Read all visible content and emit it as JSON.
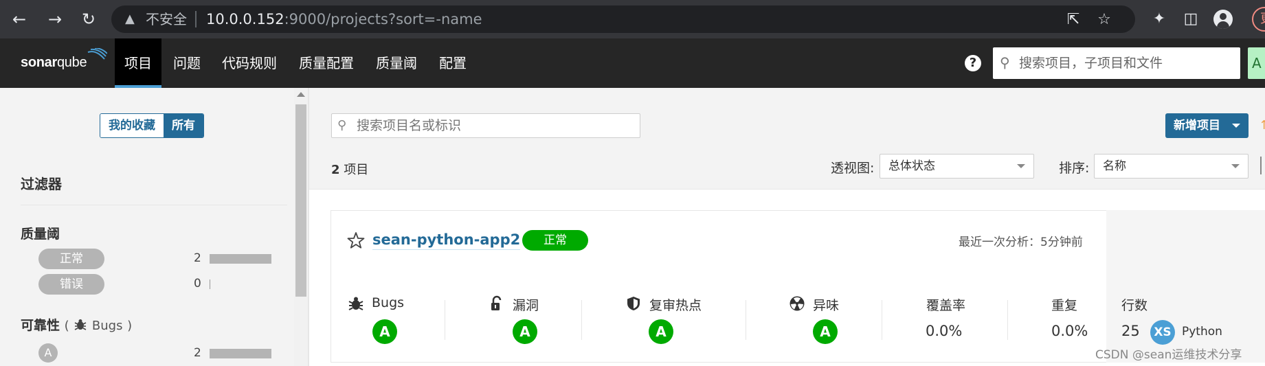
{
  "browser": {
    "security_text": "不安全",
    "url_host": "10.0.0.152",
    "url_rest": ":9000/projects?sort=-name",
    "update_label": "更"
  },
  "nav": {
    "logo_sonar": "sonar",
    "logo_qube": "qube",
    "items": [
      {
        "label": "项目",
        "active": true
      },
      {
        "label": "问题"
      },
      {
        "label": "代码规则"
      },
      {
        "label": "质量配置"
      },
      {
        "label": "质量阈"
      },
      {
        "label": "配置"
      }
    ],
    "help_label": "?",
    "search_placeholder": "搜索项目，子项目和文件",
    "new_chip": "A"
  },
  "sidebar": {
    "toggle_favorites": "我的收藏",
    "toggle_all": "所有",
    "filters_title": "过滤器",
    "quality_gate": {
      "title": "质量阈",
      "items": [
        {
          "label": "正常",
          "count": "2",
          "fraction": 1.0
        },
        {
          "label": "错误",
          "count": "0",
          "fraction": 0.0
        }
      ]
    },
    "reliability": {
      "title": "可靠性",
      "sub_open": "(",
      "sub_label": "Bugs",
      "sub_close": ")",
      "items": [
        {
          "rating": "A",
          "count": "2",
          "fraction": 1.0
        }
      ]
    }
  },
  "main": {
    "search_placeholder": "搜索项目名或标识",
    "create_button": "新增项目",
    "count_number": "2",
    "count_label": "项目",
    "perspective_label": "透视图:",
    "perspective_value": "总体状态",
    "sort_label": "排序:",
    "sort_value": "名称"
  },
  "project": {
    "name": "sean-python-app2",
    "status": "正常",
    "last_analysis": "最近一次分析：5分钟前",
    "metrics": {
      "bugs_label": "Bugs",
      "bugs_rating": "A",
      "vulnerabilities_label": "漏洞",
      "vulnerabilities_rating": "A",
      "hotspots_label": "复审热点",
      "hotspots_rating": "A",
      "smells_label": "异味",
      "smells_rating": "A",
      "coverage_label": "覆盖率",
      "coverage_value": "0.0%",
      "duplication_label": "重复",
      "duplication_value": "0.0%",
      "lines_label": "行数",
      "lines_value": "25",
      "size_badge": "XS",
      "language": "Python"
    }
  },
  "watermark": "CSDN @sean运维技术分享",
  "colors": {
    "accent": "#236a97",
    "passed": "#00aa00",
    "nav_bg": "#262626",
    "active_underline": "#4b9fd5"
  }
}
